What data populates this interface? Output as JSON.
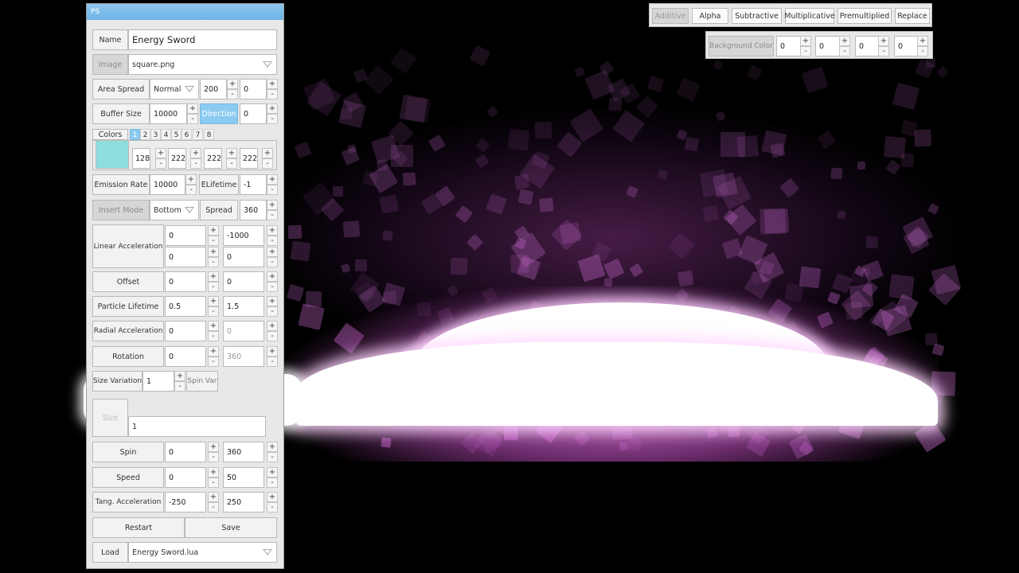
{
  "window": {
    "title": "PS"
  },
  "name": {
    "label": "Name",
    "value": "Energy Sword"
  },
  "image": {
    "label": "Image",
    "value": "square.png"
  },
  "area_spread": {
    "label": "Area Spread",
    "mode": "Normal",
    "x": "200",
    "y": "0"
  },
  "buffer_size": {
    "label": "Buffer Size",
    "value": "10000",
    "direction_label": "Direction",
    "direction_value": "0"
  },
  "colors": {
    "label": "Colors",
    "tabs": [
      "1",
      "2",
      "3",
      "4",
      "5",
      "6",
      "7",
      "8"
    ],
    "active_tab": "1",
    "swatch_color": "#8fdede",
    "r": "128",
    "g": "222",
    "b": "222",
    "a": "222"
  },
  "emission": {
    "label": "Emission Rate",
    "value": "10000",
    "elifetime_label": "ELifetime",
    "elifetime_value": "-1"
  },
  "insert_mode": {
    "label": "Insert Mode",
    "value": "Bottom",
    "spread_label": "Spread",
    "spread_value": "360"
  },
  "linear_accel": {
    "label": "Linear Acceleration",
    "xmin": "0",
    "ymin": "-1000",
    "xmax": "0",
    "ymax": "0"
  },
  "offset": {
    "label": "Offset",
    "x": "0",
    "y": "0"
  },
  "particle_lifetime": {
    "label": "Particle Lifetime",
    "min": "0.5",
    "max": "1.5"
  },
  "radial_accel": {
    "label": "Radial Acceleration",
    "min": "0",
    "max": "0"
  },
  "rotation": {
    "label": "Rotation",
    "min": "0",
    "max": "360"
  },
  "size_variation": {
    "label": "Size Variation",
    "value": "1",
    "spin_var_label": "Spin Var"
  },
  "sizes": {
    "label": "Size",
    "value": "1"
  },
  "spin": {
    "label": "Spin",
    "min": "0",
    "max": "360"
  },
  "speed": {
    "label": "Speed",
    "min": "0",
    "max": "50"
  },
  "tang_accel": {
    "label": "Tang. Acceleration",
    "min": "-250",
    "max": "250"
  },
  "actions": {
    "restart": "Restart",
    "save": "Save"
  },
  "load": {
    "label": "Load",
    "value": "Energy Sword.lua"
  },
  "stepper": {
    "plus": "+",
    "minus": "-"
  },
  "blend_modes": {
    "items": [
      "Additive",
      "Alpha",
      "Subtractive",
      "Multiplicative",
      "Premultiplied",
      "Replace"
    ],
    "disabled": "Additive"
  },
  "background_color": {
    "label": "Background Color",
    "r": "0",
    "g": "0",
    "b": "0",
    "a": "0"
  },
  "colors_theme": {
    "accent": "#8ccbf1",
    "particle": "#d070d8",
    "particle_core": "#ffffff"
  }
}
